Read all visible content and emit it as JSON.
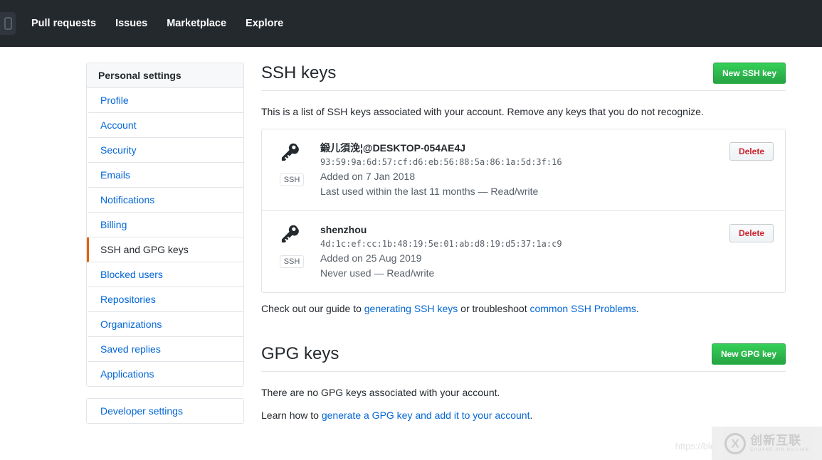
{
  "topnav": {
    "logo_icon": "github-mark-icon",
    "links": [
      {
        "label": "Pull requests"
      },
      {
        "label": "Issues"
      },
      {
        "label": "Marketplace"
      },
      {
        "label": "Explore"
      }
    ]
  },
  "sidebar": {
    "heading": "Personal settings",
    "items": [
      {
        "label": "Profile",
        "selected": false
      },
      {
        "label": "Account",
        "selected": false
      },
      {
        "label": "Security",
        "selected": false
      },
      {
        "label": "Emails",
        "selected": false
      },
      {
        "label": "Notifications",
        "selected": false
      },
      {
        "label": "Billing",
        "selected": false
      },
      {
        "label": "SSH and GPG keys",
        "selected": true
      },
      {
        "label": "Blocked users",
        "selected": false
      },
      {
        "label": "Repositories",
        "selected": false
      },
      {
        "label": "Organizations",
        "selected": false
      },
      {
        "label": "Saved replies",
        "selected": false
      },
      {
        "label": "Applications",
        "selected": false
      }
    ],
    "developer_settings": "Developer settings"
  },
  "ssh_section": {
    "title": "SSH keys",
    "new_button": "New SSH key",
    "intro": "This is a list of SSH keys associated with your account. Remove any keys that you do not recognize.",
    "keys": [
      {
        "title": "鍛儿須浼¦@DESKTOP-054AE4J",
        "fingerprint": "93:59:9a:6d:57:cf:d6:eb:56:88:5a:86:1a:5d:3f:16",
        "added": "Added on 7 Jan 2018",
        "usage": "Last used within the last 11 months — Read/write",
        "badge": "SSH",
        "icon": "key-icon",
        "delete_label": "Delete"
      },
      {
        "title": "shenzhou",
        "fingerprint": "4d:1c:ef:cc:1b:48:19:5e:01:ab:d8:19:d5:37:1a:c9",
        "added": "Added on 25 Aug 2019",
        "usage": "Never used — Read/write",
        "badge": "SSH",
        "icon": "key-icon",
        "delete_label": "Delete"
      }
    ],
    "help": {
      "prefix": "Check out our guide to ",
      "link1": "generating SSH keys",
      "middle": " or troubleshoot ",
      "link2": "common SSH Problems",
      "suffix": "."
    }
  },
  "gpg_section": {
    "title": "GPG keys",
    "new_button": "New GPG key",
    "empty": "There are no GPG keys associated with your account.",
    "learn_prefix": "Learn how to ",
    "learn_link": "generate a GPG key and add it to your account",
    "learn_suffix": "."
  },
  "watermark": {
    "cn": "创新互联",
    "pinyin": "CHUANG XIN HU LIAN",
    "url": "https://blo"
  },
  "colors": {
    "nav_bg": "#24292e",
    "link": "#0366d6",
    "green": "#28a745",
    "danger": "#cb2431",
    "active_border": "#e36209",
    "border": "#e1e4e8",
    "muted": "#586069"
  }
}
